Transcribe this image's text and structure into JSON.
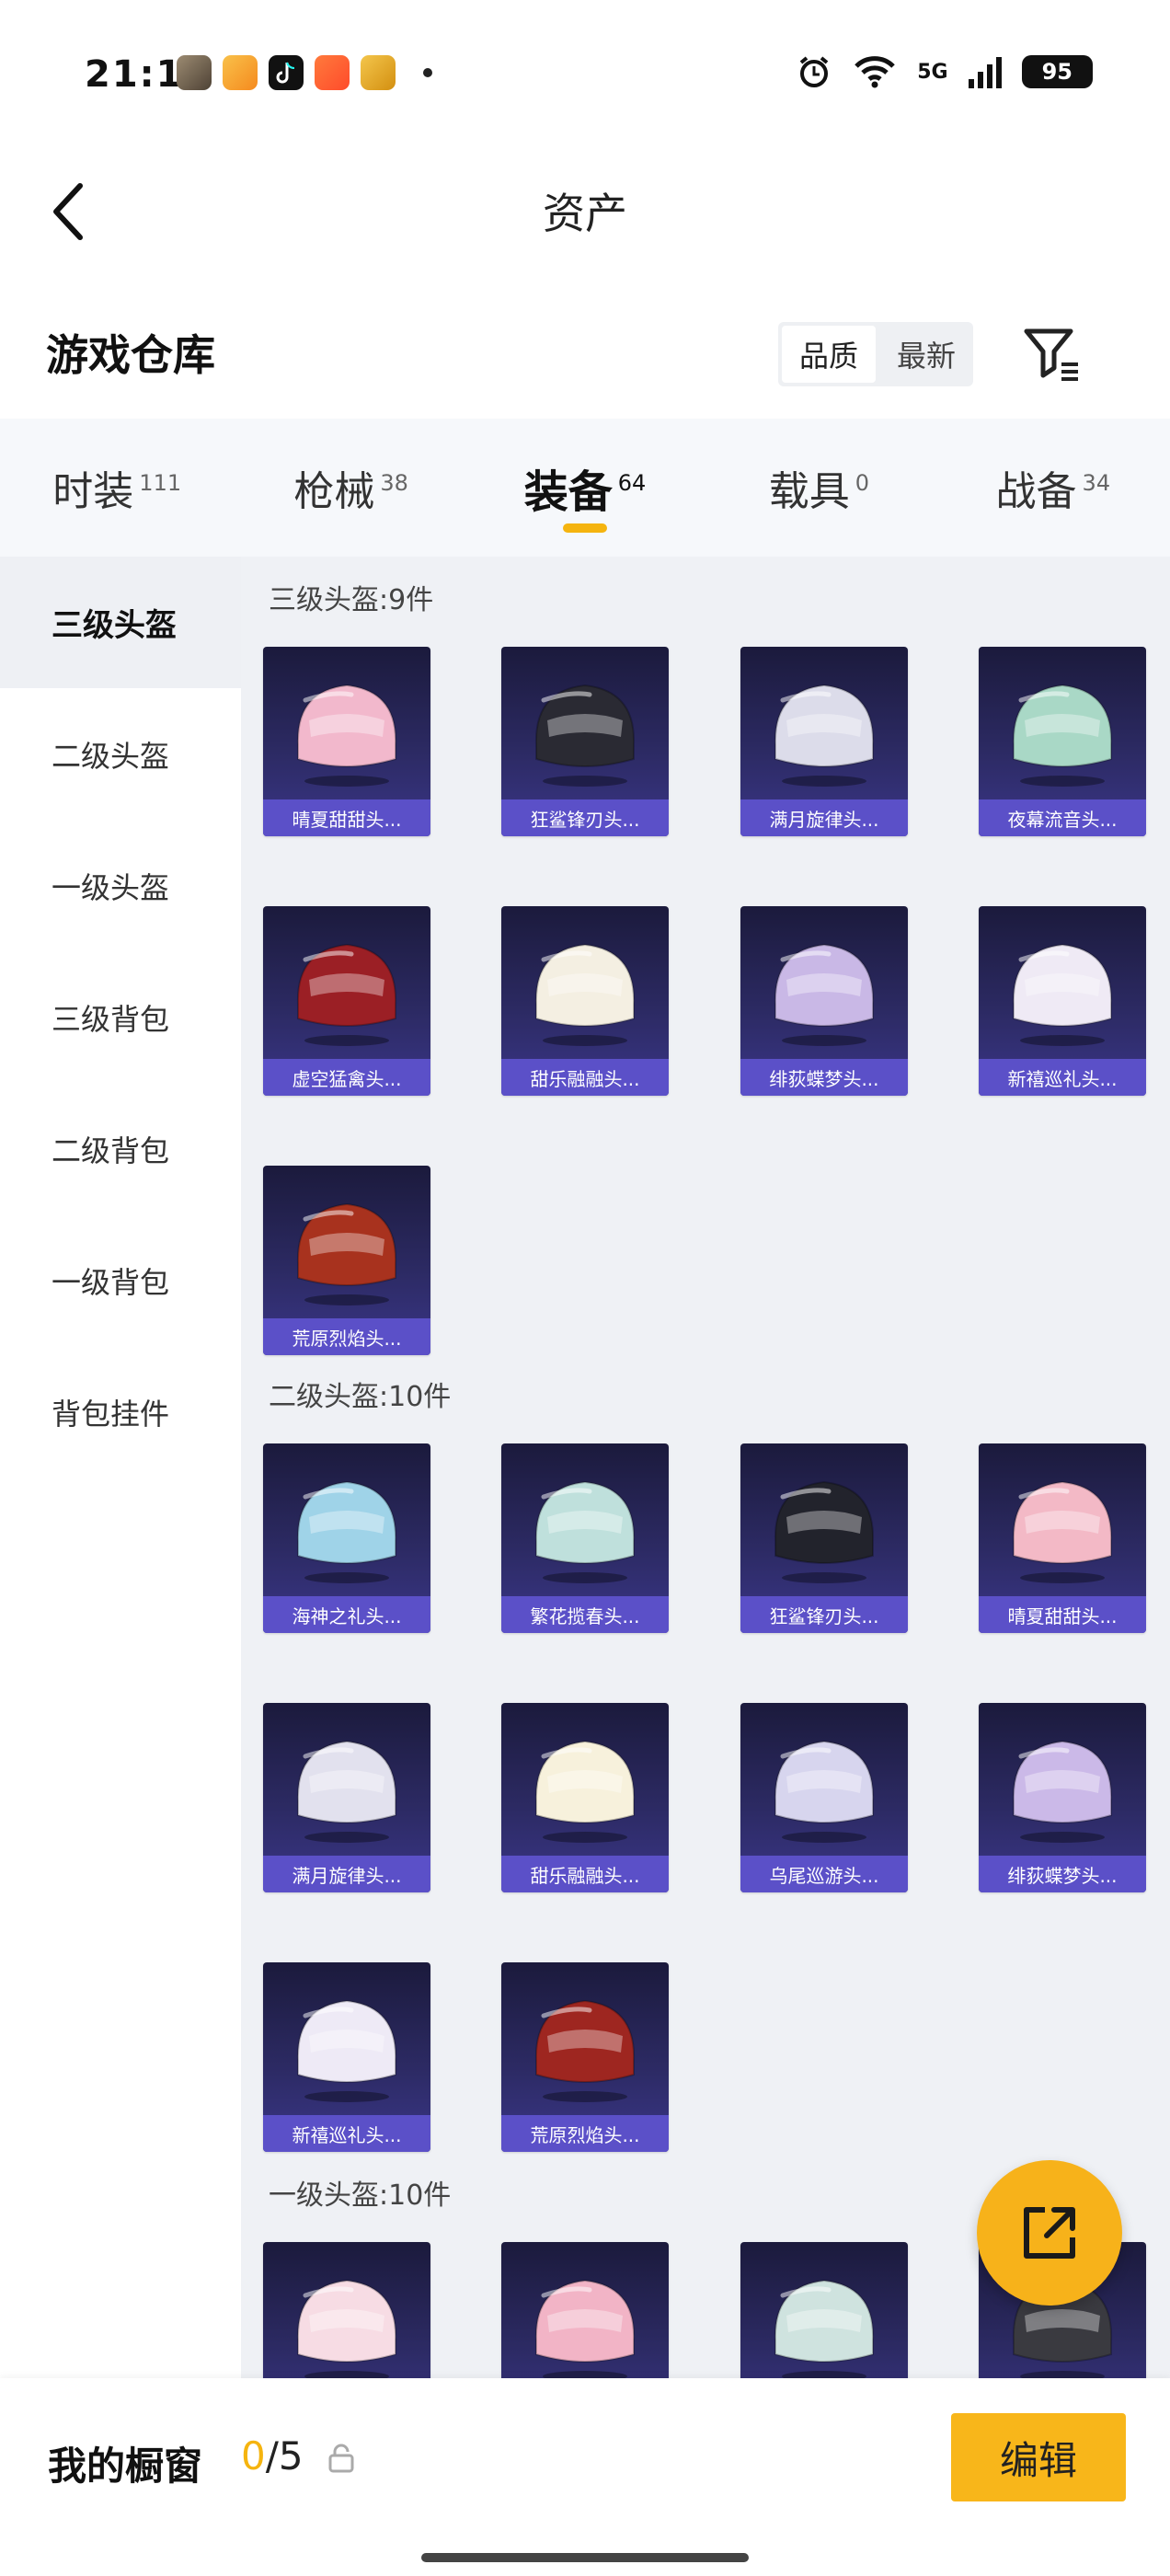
{
  "status": {
    "time": "21:10",
    "network": "5G",
    "battery": "95",
    "app_icons": [
      "game-app-icon",
      "shopping-app-icon",
      "tiktok-icon",
      "video-app-icon",
      "game-center-icon"
    ],
    "colors": {
      "app1": "#7a6a55",
      "app2": "#f59a1e",
      "app3": "#111111",
      "app4": "#ff5b2e",
      "app5": "#e0a21a"
    }
  },
  "header": {
    "title": "资产"
  },
  "warehouse": {
    "title": "游戏仓库",
    "sort_options": [
      "品质",
      "最新"
    ],
    "sort_selected": "品质"
  },
  "tabs": [
    {
      "label": "时装",
      "count": "111"
    },
    {
      "label": "枪械",
      "count": "38"
    },
    {
      "label": "装备",
      "count": "64",
      "active": true
    },
    {
      "label": "载具",
      "count": "0"
    },
    {
      "label": "战备",
      "count": "34"
    }
  ],
  "sidebar": [
    {
      "label": "三级头盔",
      "active": true
    },
    {
      "label": "二级头盔"
    },
    {
      "label": "一级头盔"
    },
    {
      "label": "三级背包"
    },
    {
      "label": "二级背包"
    },
    {
      "label": "一级背包"
    },
    {
      "label": "背包挂件"
    }
  ],
  "sections": [
    {
      "title": "三级头盔:9件",
      "items": [
        {
          "name": "晴夏甜甜头...",
          "color": "#f2b8cc"
        },
        {
          "name": "狂鲨锋刃头...",
          "color": "#2a2a33"
        },
        {
          "name": "满月旋律头...",
          "color": "#dcdcea"
        },
        {
          "name": "夜幕流音头...",
          "color": "#a9d8c6"
        },
        {
          "name": "虚空猛禽头...",
          "color": "#9b1f25"
        },
        {
          "name": "甜乐融融头...",
          "color": "#f4efe2"
        },
        {
          "name": "绯荻蝶梦头...",
          "color": "#c9b8e6"
        },
        {
          "name": "新禧巡礼头...",
          "color": "#efeaf5"
        },
        {
          "name": "荒原烈焰头...",
          "color": "#a8321e"
        }
      ]
    },
    {
      "title": "二级头盔:10件",
      "items": [
        {
          "name": "海神之礼头...",
          "color": "#9fd3e8"
        },
        {
          "name": "繁花揽春头...",
          "color": "#bfe0dc"
        },
        {
          "name": "狂鲨锋刃头...",
          "color": "#22232c"
        },
        {
          "name": "晴夏甜甜头...",
          "color": "#f3b9c6"
        },
        {
          "name": "满月旋律头...",
          "color": "#e2e1ee"
        },
        {
          "name": "甜乐融融头...",
          "color": "#f7f1dc"
        },
        {
          "name": "乌尾巡游头...",
          "color": "#d7d5ee"
        },
        {
          "name": "绯荻蝶梦头...",
          "color": "#cbb9e8"
        },
        {
          "name": "新禧巡礼头...",
          "color": "#eeeaf6"
        },
        {
          "name": "荒原烈焰头...",
          "color": "#9e2620"
        }
      ]
    },
    {
      "title": "一级头盔:10件",
      "items": [
        {
          "name": "",
          "color": "#f7dce4"
        },
        {
          "name": "",
          "color": "#f2b4c6"
        },
        {
          "name": "",
          "color": "#cfe3df"
        },
        {
          "name": "",
          "color": "#3a3a40"
        }
      ]
    }
  ],
  "fab": {
    "icon": "share-external-icon"
  },
  "bottom": {
    "label": "我的橱窗",
    "current": "0",
    "total": "/5",
    "edit_label": "编辑"
  },
  "accent": "#f5b40f"
}
